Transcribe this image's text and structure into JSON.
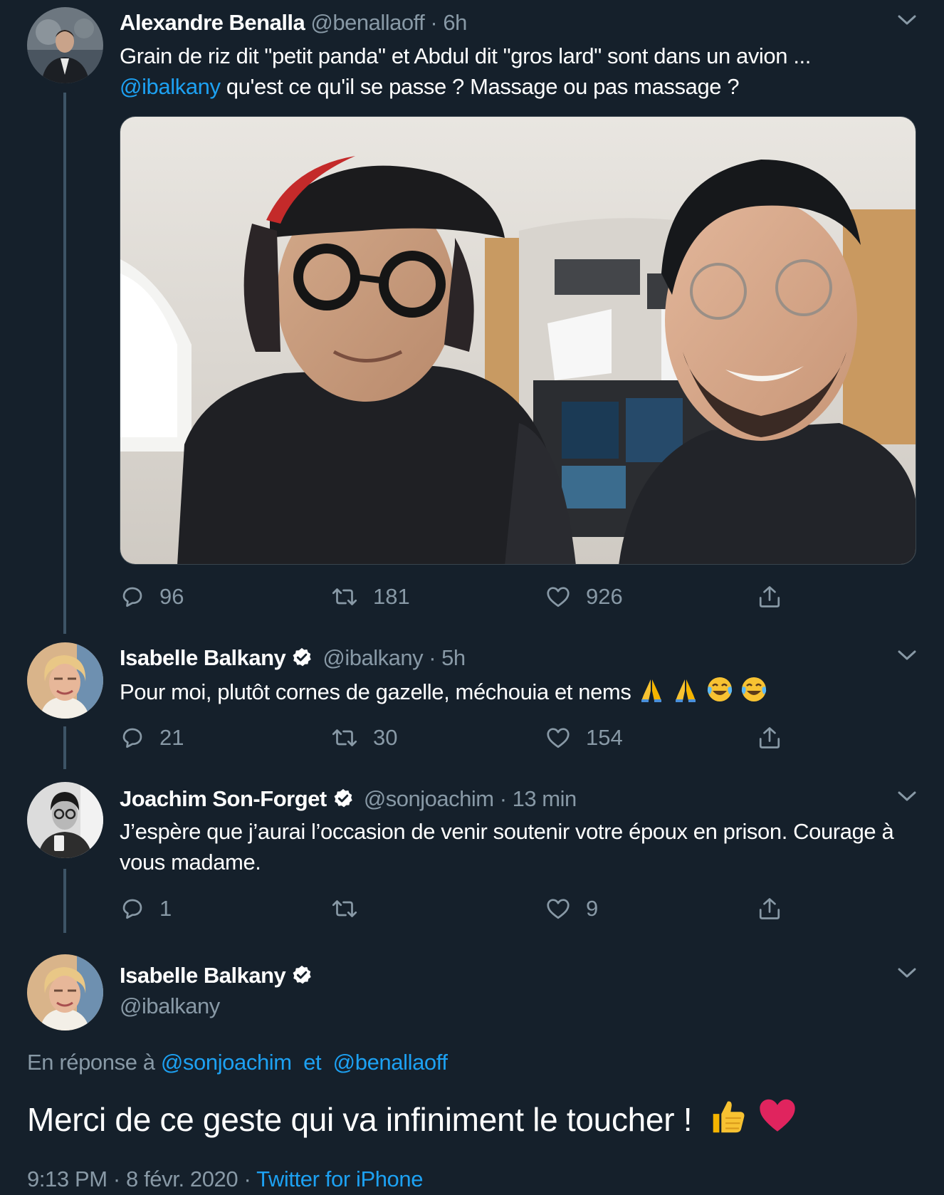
{
  "tweets": [
    {
      "name": "Alexandre Benalla",
      "handle": "@benallaoff",
      "time": "· 6h",
      "text_line1": "Grain de riz dit \"petit panda\" et Abdul dit \"gros lard\" sont dans un avion ...",
      "mention": "@ibalkany",
      "text_line2": " qu'est ce qu'il se passe ? Massage ou pas massage ?",
      "replies": "96",
      "retweets": "181",
      "likes": "926"
    },
    {
      "name": "Isabelle Balkany",
      "handle": "@ibalkany",
      "time": "· 5h",
      "text": "Pour moi, plutôt cornes de gazelle, méchouia et nems",
      "replies": "21",
      "retweets": "30",
      "likes": "154"
    },
    {
      "name": "Joachim Son-Forget",
      "handle": "@sonjoachim",
      "time": "· 13 min",
      "text": "J’espère que j’aurai l’occasion de venir soutenir votre époux en prison. Courage à vous madame.",
      "replies": "1",
      "retweets": "",
      "likes": "9"
    }
  ],
  "main": {
    "name": "Isabelle Balkany",
    "handle": "@ibalkany",
    "reply_prefix": "En réponse à",
    "reply_user1": "@sonjoachim",
    "reply_and": "et",
    "reply_user2": "@benallaoff",
    "text": "Merci de ce geste qui va infiniment le toucher !",
    "time": "9:13 PM",
    "date": "8 févr. 2020",
    "source": "Twitter for iPhone"
  },
  "icons": {
    "reply": "reply-icon",
    "retweet": "retweet-icon",
    "like": "heart-icon",
    "share": "share-icon",
    "more": "chevron-down-icon",
    "verified": "verified-badge-icon"
  },
  "colors": {
    "background": "#15202b",
    "link": "#1da1f2",
    "muted": "#8899a6",
    "verified": "#ffffff"
  }
}
